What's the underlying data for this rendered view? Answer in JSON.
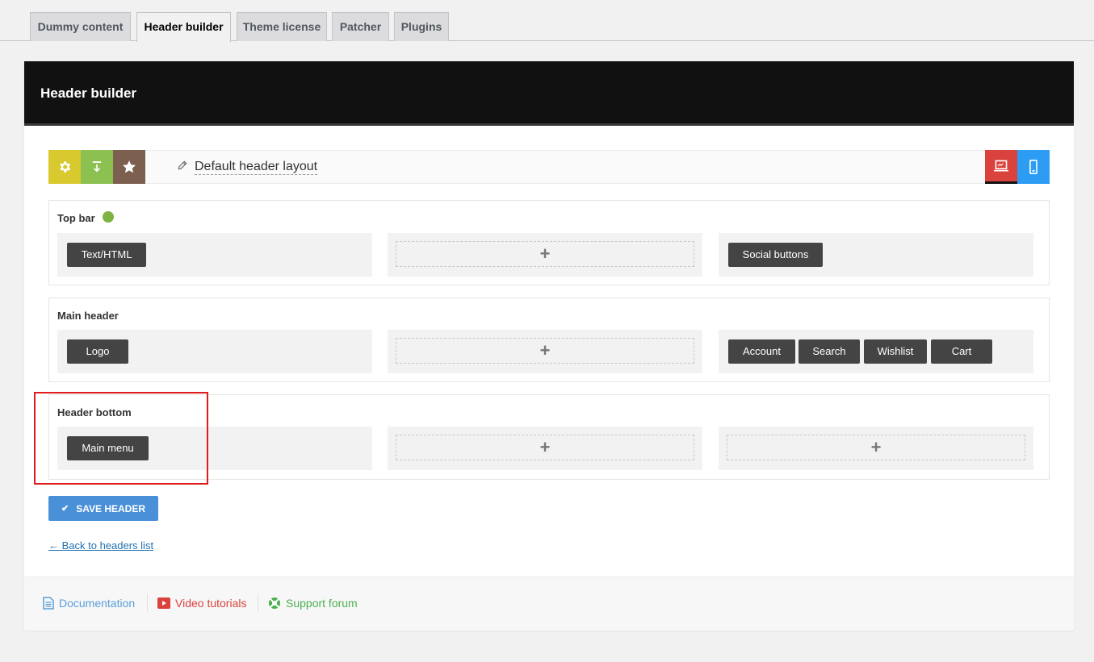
{
  "tabs": [
    {
      "label": "Dummy content"
    },
    {
      "label": "Header builder"
    },
    {
      "label": "Theme license"
    },
    {
      "label": "Patcher"
    },
    {
      "label": "Plugins"
    }
  ],
  "panel": {
    "title": "Header builder"
  },
  "toolbar": {
    "layout_name": "Default header layout",
    "tool_colors": {
      "settings": "#d8c92f",
      "import": "#8cc152",
      "favorite": "#7d5f4f"
    },
    "view_colors": {
      "desktop": "#d9423d",
      "mobile": "#2d9cf4"
    }
  },
  "rows": {
    "top_bar": {
      "title": "Top bar",
      "left": [
        "Text/HTML"
      ],
      "right": [
        "Social buttons"
      ]
    },
    "main_header": {
      "title": "Main header",
      "left": [
        "Logo"
      ],
      "right": [
        "Account",
        "Search",
        "Wishlist",
        "Cart"
      ]
    },
    "header_bottom": {
      "title": "Header bottom",
      "left": [
        "Main menu"
      ]
    }
  },
  "add_symbol": "+",
  "save_button": {
    "label": "SAVE HEADER"
  },
  "back_link": "← Back to headers list",
  "footer": {
    "documentation": "Documentation",
    "video_tutorials": "Video tutorials",
    "support_forum": "Support forum"
  }
}
